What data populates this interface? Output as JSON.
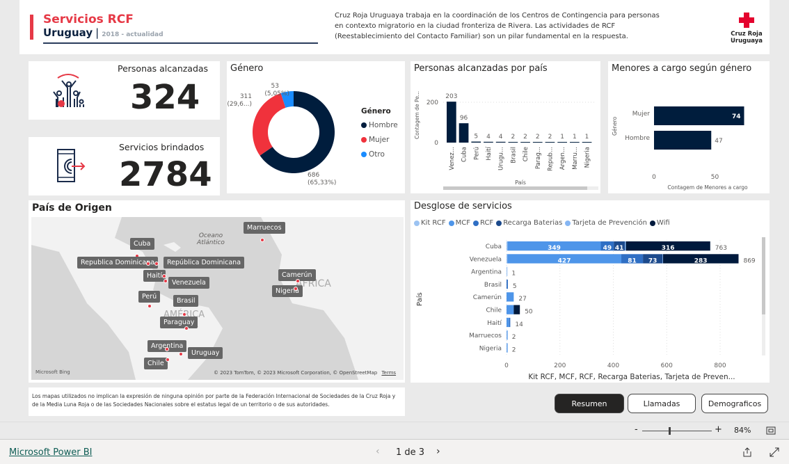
{
  "header": {
    "title": "Servicios RCF",
    "subtitle": "Uruguay",
    "period": "2018 - actualidad",
    "description": "Cruz Roja Uruguaya trabaja en la coordinación de los Centros de Contingencia para personas en contexto migratorio en la ciudad fronteriza de Rivera. Las actividades de RCF (Reestablecimiento del Contacto Familiar) son un pilar fundamental en la respuesta.",
    "logo_text": "Cruz Roja Uruguaya"
  },
  "kpis": [
    {
      "label": "Personas alcanzadas",
      "value": "324",
      "icon": "people-icon"
    },
    {
      "label": "Servicios brindados",
      "value": "2784",
      "icon": "phone-signal-icon"
    }
  ],
  "colors": {
    "accent": "#e63946",
    "navy": "#001d3d",
    "mujer": "#f0323c",
    "otro": "#1a8cff"
  },
  "chart_data": [
    {
      "type": "pie",
      "title": "Género",
      "legend_title": "Género",
      "legend": "right",
      "slices": [
        {
          "name": "Hombre",
          "value": 686,
          "label": "686",
          "pct": "(65,33%)",
          "color": "#001d3d"
        },
        {
          "name": "Mujer",
          "value": 311,
          "label": "311",
          "pct": "(29,6...)",
          "color": "#f0323c"
        },
        {
          "name": "Otro",
          "value": 53,
          "label": "53",
          "pct": "(5,05%)",
          "color": "#1a8cff"
        }
      ]
    },
    {
      "type": "bar",
      "title": "Personas alcanzadas por país",
      "xlabel": "País",
      "ylabel": "Contagem de Pe...",
      "categories": [
        "Venez...",
        "Cuba",
        "Perú",
        "Haití",
        "Urugu...",
        "Brasil",
        "Chile",
        "Parag...",
        "Repub...",
        "Argen...",
        "Marru...",
        "Nigeria"
      ],
      "values": [
        203,
        96,
        5,
        4,
        4,
        2,
        2,
        2,
        2,
        1,
        1,
        1
      ],
      "yticks": [
        "0",
        "200"
      ],
      "ylim": [
        0,
        230
      ]
    },
    {
      "type": "bar",
      "orientation": "horizontal",
      "title": "Menores a cargo según género",
      "xlabel": "Contagem de Menores a cargo",
      "ylabel": "Género",
      "categories": [
        "Mujer",
        "Hombre"
      ],
      "values": [
        74,
        47
      ],
      "xticks": [
        "0",
        "50"
      ],
      "xlim": [
        0,
        80
      ]
    },
    {
      "type": "bar",
      "orientation": "horizontal",
      "stacked": true,
      "title": "Desglose de servicios",
      "xlabel": "Kit RCF, MCF, RCF, Recarga Baterias, Tarjeta de Preven...",
      "ylabel": "País",
      "xticks": [
        "0",
        "200",
        "400",
        "600",
        "800"
      ],
      "xlim": [
        0,
        900
      ],
      "categories": [
        "Cuba",
        "Venezuela",
        "Argentina",
        "Brasil",
        "Camerún",
        "Chile",
        "Haití",
        "Marruecos",
        "Nigeria"
      ],
      "totals": [
        763,
        869,
        1,
        5,
        27,
        50,
        14,
        2,
        2
      ],
      "series": [
        {
          "name": "Kit RCF",
          "color": "#9cc3f2",
          "values": [
            4,
            3,
            1,
            0,
            0,
            0,
            0,
            1,
            1
          ]
        },
        {
          "name": "MCF",
          "color": "#4e95e9",
          "values": [
            349,
            427,
            0,
            0,
            27,
            27,
            10,
            1,
            1
          ]
        },
        {
          "name": "RCF",
          "color": "#2f6fc4",
          "values": [
            49,
            81,
            0,
            5,
            0,
            0,
            4,
            0,
            0
          ]
        },
        {
          "name": "Recarga Baterias",
          "color": "#1c4a8c",
          "values": [
            41,
            73,
            0,
            0,
            0,
            0,
            0,
            0,
            0
          ]
        },
        {
          "name": "Tarjeta de Prevención",
          "color": "#86b6f3",
          "values": [
            4,
            2,
            0,
            0,
            0,
            0,
            0,
            0,
            0
          ]
        },
        {
          "name": "Wifi",
          "color": "#001a3d",
          "values": [
            316,
            283,
            0,
            0,
            0,
            23,
            0,
            0,
            0
          ]
        }
      ]
    }
  ],
  "map": {
    "title": "País de Origen",
    "labels": [
      "Marruecos",
      "Cuba",
      "Republica Dominicana",
      "República Dominicana",
      "Haití",
      "Venezuela",
      "Camerún",
      "Nigeria",
      "Perú",
      "Brasil",
      "Paraguay",
      "Argentina",
      "Uruguay",
      "Chile"
    ],
    "ocean_label": "Oceano Atlántico",
    "continent_labels": [
      "ÁFRICA",
      "AMÉRICA DO SUL"
    ],
    "attribution": "© 2023 TomTom, © 2023 Microsoft Corporation, © OpenStreetMap",
    "terms": "Terms",
    "bing": "Microsoft Bing"
  },
  "disclaimer": "Los mapas utilizados no implican la expresión de ninguna opinión por parte de la Federación Internacional de Sociedades de la Cruz Roja y de la Media Luna Roja o de las Sociedades Nacionales sobre el estatus legal de un territorio o de sus autoridades.",
  "nav_buttons": [
    "Resumen",
    "Llamadas",
    "Demograficos"
  ],
  "zoom": {
    "minus": "-",
    "plus": "+",
    "level": "84%"
  },
  "footer": {
    "brand": "Microsoft Power BI",
    "page": "1 de 3"
  }
}
